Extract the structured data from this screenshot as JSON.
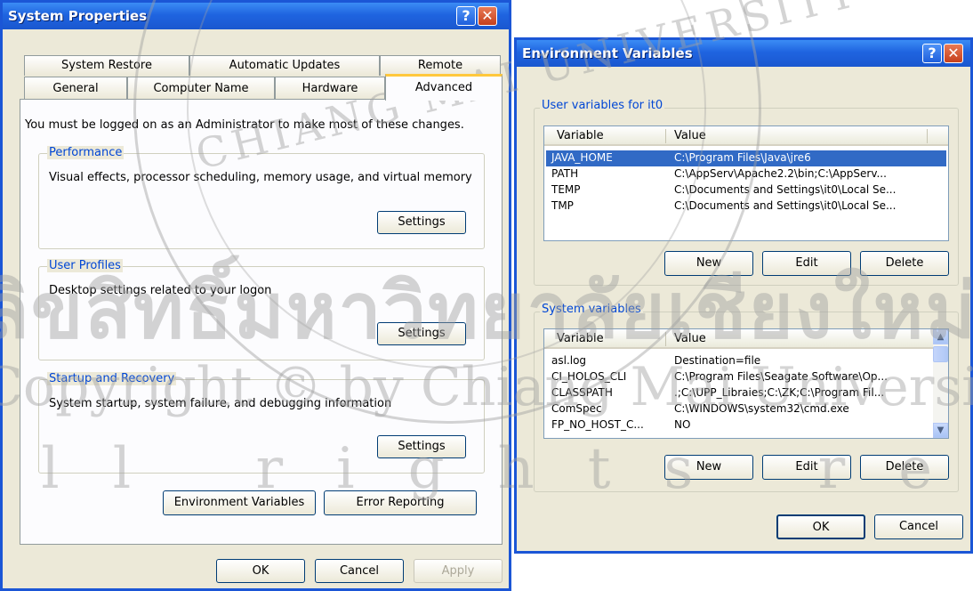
{
  "system_properties": {
    "title": "System Properties",
    "help_glyph": "?",
    "close_glyph": "✕",
    "tabs_back": [
      "System Restore",
      "Automatic Updates",
      "Remote"
    ],
    "tabs_front": [
      "General",
      "Computer Name",
      "Hardware",
      "Advanced"
    ],
    "active_tab": "Advanced",
    "admin_note": "You must be logged on as an Administrator to make most of these changes.",
    "performance": {
      "label": "Performance",
      "description": "Visual effects, processor scheduling, memory usage, and virtual memory",
      "button": "Settings"
    },
    "user_profiles": {
      "label": "User Profiles",
      "description": "Desktop settings related to your logon",
      "button": "Settings"
    },
    "startup_recovery": {
      "label": "Startup and Recovery",
      "description": "System startup, system failure, and debugging information",
      "button": "Settings"
    },
    "env_button": "Environment Variables",
    "error_button": "Error Reporting",
    "ok": "OK",
    "cancel": "Cancel",
    "apply": "Apply"
  },
  "env_vars": {
    "title": "Environment Variables",
    "help_glyph": "?",
    "close_glyph": "✕",
    "user_group_label": "User variables for it0",
    "columns": [
      "Variable",
      "Value"
    ],
    "user_vars": [
      {
        "name": "JAVA_HOME",
        "value": "C:\\Program Files\\Java\\jre6",
        "selected": true
      },
      {
        "name": "PATH",
        "value": "C:\\AppServ\\Apache2.2\\bin;C:\\AppServ..."
      },
      {
        "name": "TEMP",
        "value": "C:\\Documents and Settings\\it0\\Local Se..."
      },
      {
        "name": "TMP",
        "value": "C:\\Documents and Settings\\it0\\Local Se..."
      }
    ],
    "user_buttons": {
      "new": "New",
      "edit": "Edit",
      "delete": "Delete"
    },
    "system_group_label": "System variables",
    "system_vars": [
      {
        "name": "asl.log",
        "value": "Destination=file"
      },
      {
        "name": "CI_HOLOS_CLI",
        "value": "C:\\Program Files\\Seagate Software\\Op..."
      },
      {
        "name": "CLASSPATH",
        "value": ".;C:\\UPP_Libraies;C:\\ZK;C:\\Program Fil..."
      },
      {
        "name": "ComSpec",
        "value": "C:\\WINDOWS\\system32\\cmd.exe"
      },
      {
        "name": "FP_NO_HOST_C...",
        "value": "NO"
      }
    ],
    "system_buttons": {
      "new": "New",
      "edit": "Edit",
      "delete": "Delete"
    },
    "scroll_up": "▲",
    "scroll_down": "▼",
    "ok": "OK",
    "cancel": "Cancel"
  },
  "watermark": {
    "thai": "ลิขสิทธิ์มหาวิทยาลัยเชียงใหม่",
    "copyright": "Copyright © by Chiang Mai University",
    "rights": "All rights reserved",
    "seal_text": "CHIANG MAI UNIVERSITY"
  }
}
